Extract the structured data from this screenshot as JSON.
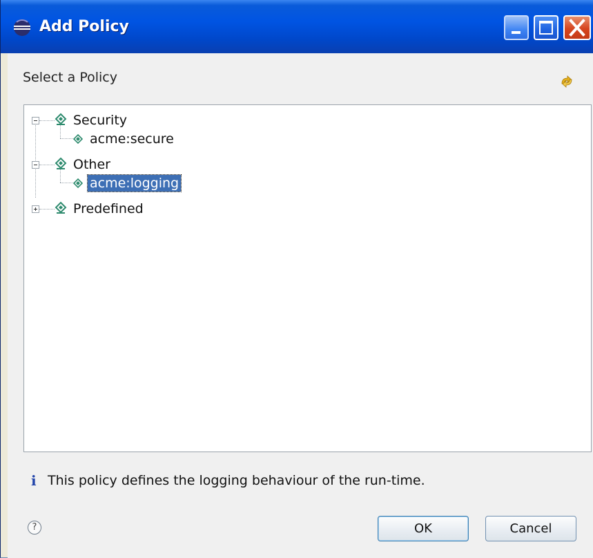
{
  "window": {
    "title": "Add Policy",
    "icons": {
      "app": "eclipse-sphere-icon",
      "minimize": "minimize-icon",
      "maximize": "maximize-icon",
      "close": "close-icon"
    }
  },
  "header": {
    "label": "Select a Policy",
    "refresh_icon": "refresh-icon"
  },
  "tree": {
    "nodes": [
      {
        "label": "Security",
        "expanded": true,
        "children": [
          {
            "label": "acme:secure",
            "selected": false
          }
        ]
      },
      {
        "label": "Other",
        "expanded": true,
        "children": [
          {
            "label": "acme:logging",
            "selected": true
          }
        ]
      },
      {
        "label": "Predefined",
        "expanded": false,
        "children": []
      }
    ]
  },
  "info": {
    "icon": "info-icon",
    "message": "This policy defines the logging behaviour of the run-time."
  },
  "buttons": {
    "help_icon": "help-icon",
    "ok_label": "OK",
    "cancel_label": "Cancel"
  },
  "colors": {
    "titlebar": "#0054e3",
    "selection": "#3d6fb5",
    "dialog_bg": "#f0f0f0"
  }
}
